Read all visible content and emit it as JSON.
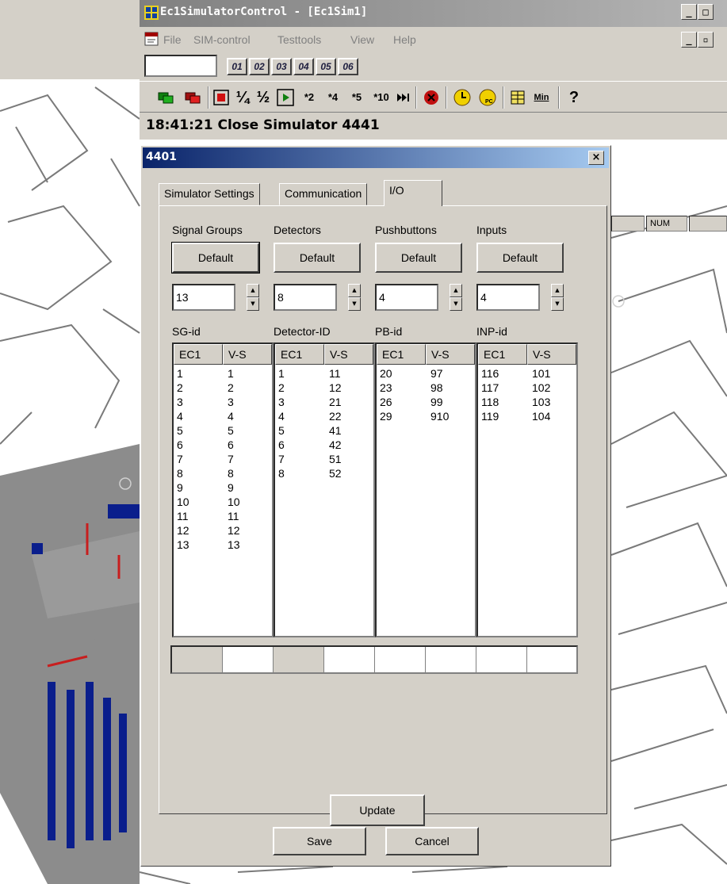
{
  "app": {
    "title": "Ec1SimulatorControl - [Ec1Sim1]",
    "menu": [
      "File",
      "SIM-control",
      "Testtools",
      "View",
      "Help"
    ],
    "num_buttons": [
      "01",
      "02",
      "03",
      "04",
      "05",
      "06"
    ],
    "toolbar": {
      "quarter": "¼",
      "half": "½",
      "x2": "*2",
      "x4": "*4",
      "x5": "*5",
      "x10": "*10",
      "min": "Min",
      "help": "?"
    },
    "status_message": "18:41:21 Close Simulator 4441",
    "status_num": "NUM"
  },
  "dialog": {
    "title": "4401",
    "close": "×",
    "tabs": [
      "Simulator Settings",
      "Communication",
      "I/O"
    ],
    "active_tab": "I/O",
    "groups": [
      {
        "label": "Signal Groups",
        "button": "Default",
        "count": "13",
        "id_label": "SG-id",
        "col1": "EC1",
        "col2": "V-S",
        "rows": [
          [
            "1",
            "1"
          ],
          [
            "2",
            "2"
          ],
          [
            "3",
            "3"
          ],
          [
            "4",
            "4"
          ],
          [
            "5",
            "5"
          ],
          [
            "6",
            "6"
          ],
          [
            "7",
            "7"
          ],
          [
            "8",
            "8"
          ],
          [
            "9",
            "9"
          ],
          [
            "10",
            "10"
          ],
          [
            "11",
            "11"
          ],
          [
            "12",
            "12"
          ],
          [
            "13",
            "13"
          ]
        ]
      },
      {
        "label": "Detectors",
        "button": "Default",
        "count": "8",
        "id_label": "Detector-ID",
        "col1": "EC1",
        "col2": "V-S",
        "rows": [
          [
            "1",
            "11"
          ],
          [
            "2",
            "12"
          ],
          [
            "3",
            "21"
          ],
          [
            "4",
            "22"
          ],
          [
            "5",
            "41"
          ],
          [
            "6",
            "42"
          ],
          [
            "7",
            "51"
          ],
          [
            "8",
            "52"
          ]
        ]
      },
      {
        "label": "Pushbuttons",
        "button": "Default",
        "count": "4",
        "id_label": "PB-id",
        "col1": "EC1",
        "col2": "V-S",
        "rows": [
          [
            "20",
            "97"
          ],
          [
            "23",
            "98"
          ],
          [
            "26",
            "99"
          ],
          [
            "29",
            "910"
          ]
        ]
      },
      {
        "label": "Inputs",
        "button": "Default",
        "count": "4",
        "id_label": "INP-id",
        "col1": "EC1",
        "col2": "V-S",
        "rows": [
          [
            "116",
            "101"
          ],
          [
            "117",
            "102"
          ],
          [
            "118",
            "103"
          ],
          [
            "119",
            "104"
          ]
        ]
      }
    ],
    "update": "Update",
    "save": "Save",
    "cancel": "Cancel"
  },
  "colors": {
    "dialog_title_start": "#0a246a",
    "dialog_title_end": "#a6caf0",
    "face": "#d4d0c8",
    "map_road": "#8c8c8c",
    "map_marker_blue": "#0a1e8c",
    "map_marker_red": "#c81e1e"
  },
  "icons": [
    "app-grid-icon",
    "doc-icon",
    "green-layers-icon",
    "red-layers-icon",
    "stop-icon",
    "play-icon",
    "skip-end-icon",
    "close-red-icon",
    "clock-icon",
    "clock-pc-icon",
    "table-icon",
    "help-icon"
  ]
}
